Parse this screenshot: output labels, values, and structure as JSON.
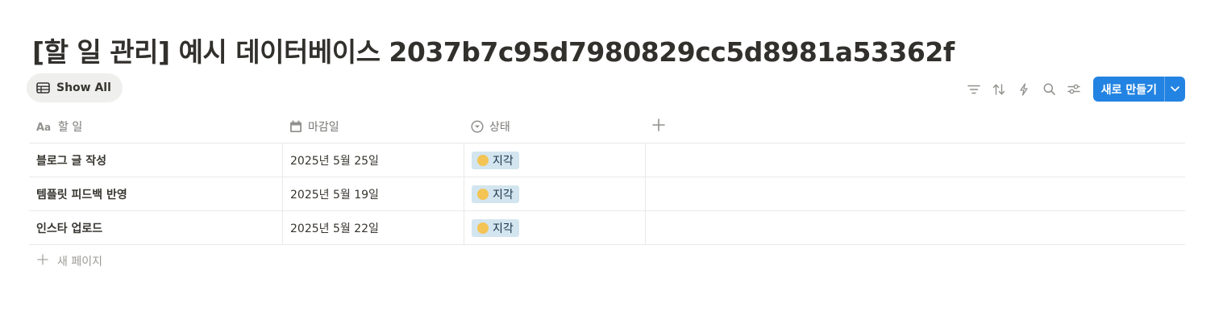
{
  "title": "[할 일 관리] 예시 데이터베이스 2037b7c95d7980829cc5d8981a53362f",
  "view_tab": {
    "label": "Show All",
    "icon": "table-icon"
  },
  "toolbar": {
    "icons": [
      "filter-icon",
      "sort-icon",
      "lightning-icon",
      "search-icon",
      "settings-sliders-icon"
    ],
    "new_button_label": "새로 만들기",
    "accent": "#2383e2"
  },
  "columns": [
    {
      "label": "할 일",
      "icon": "text-aa-icon"
    },
    {
      "label": "마감일",
      "icon": "calendar-icon"
    },
    {
      "label": "상태",
      "icon": "status-icon"
    }
  ],
  "rows": [
    {
      "name": "블로그 글 작성",
      "date": "2025년 5월 25일",
      "status": "지각"
    },
    {
      "name": "템플릿 피드백 반영",
      "date": "2025년 5월 19일",
      "status": "지각"
    },
    {
      "name": "인스타 업로드",
      "date": "2025년 5월 22일",
      "status": "지각"
    }
  ],
  "status_colors": {
    "pill_bg": "#d3e5ef",
    "dot": "#f4c454"
  },
  "new_page_label": "새 페이지"
}
